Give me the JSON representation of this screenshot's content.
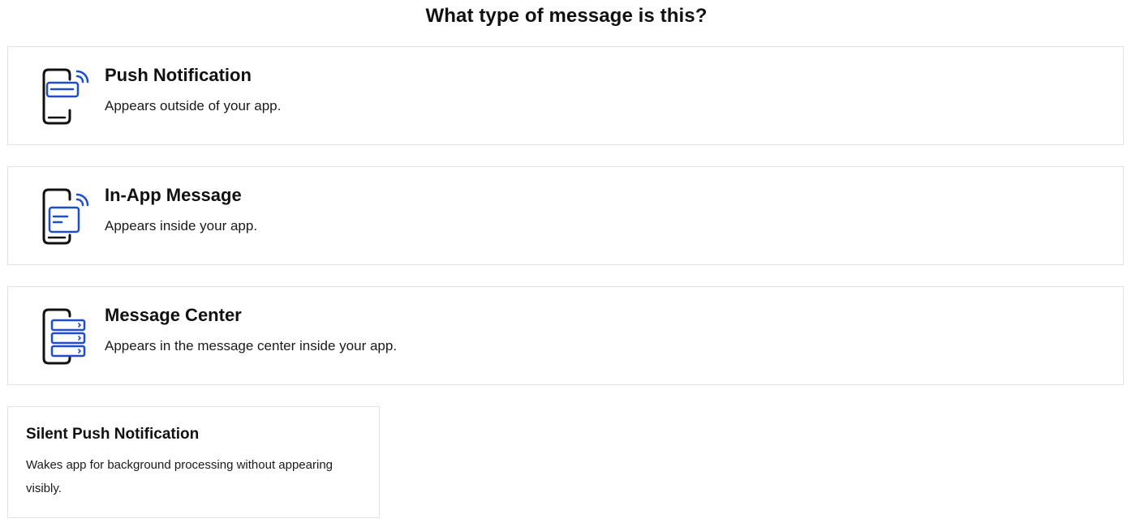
{
  "page": {
    "title": "What type of message is this?"
  },
  "colors": {
    "accent": "#1f4fc8",
    "outline": "#111111",
    "card_border": "#e3e3e3"
  },
  "options": [
    {
      "title": "Push Notification",
      "description": "Appears outside of your app.",
      "icon": "push-notification-icon"
    },
    {
      "title": "In-App Message",
      "description": "Appears inside your app.",
      "icon": "in-app-message-icon"
    },
    {
      "title": "Message Center",
      "description": "Appears in the message center inside your app.",
      "icon": "message-center-icon"
    }
  ],
  "silent_option": {
    "title": "Silent Push Notification",
    "description": "Wakes app for background processing without appearing visibly."
  }
}
